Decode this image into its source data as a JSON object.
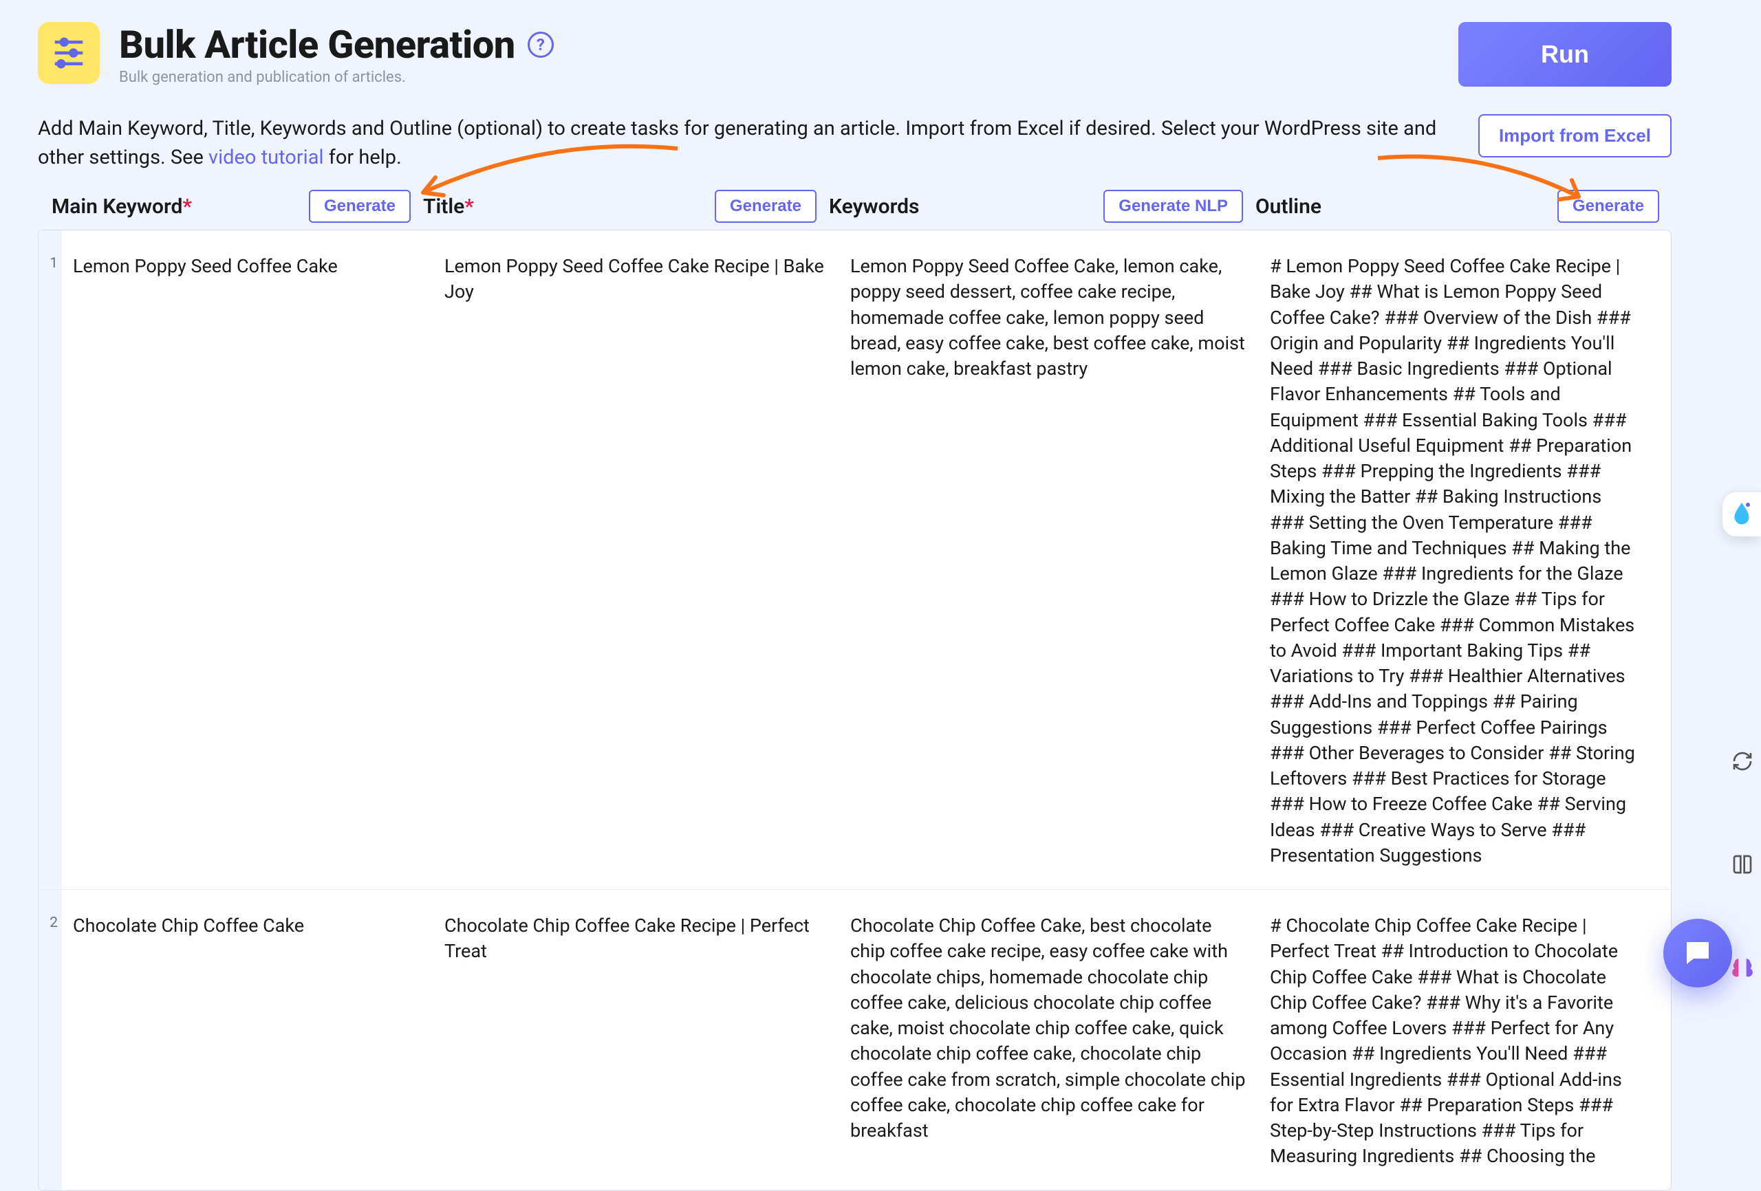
{
  "header": {
    "title": "Bulk Article Generation",
    "subtitle": "Bulk generation and publication of articles.",
    "run_label": "Run",
    "help_glyph": "?"
  },
  "intro": {
    "text_before_link": "Add Main Keyword, Title, Keywords and Outline (optional) to create tasks for generating an article. Import from Excel if desired. Select your WordPress site and other settings. See ",
    "link_text": "video tutorial",
    "text_after_link": " for help.",
    "import_label": "Import from Excel"
  },
  "columns": {
    "main_keyword": {
      "label": "Main Keyword",
      "required": true,
      "button": "Generate"
    },
    "title": {
      "label": "Title",
      "required": true,
      "button": "Generate"
    },
    "keywords": {
      "label": "Keywords",
      "required": false,
      "button": "Generate NLP"
    },
    "outline": {
      "label": "Outline",
      "required": false,
      "button": "Generate"
    }
  },
  "rows": [
    {
      "n": "1",
      "main_keyword": "Lemon Poppy Seed Coffee Cake",
      "title": "Lemon Poppy Seed Coffee Cake Recipe | Bake Joy",
      "keywords": "Lemon Poppy Seed Coffee Cake, lemon cake, poppy seed dessert, coffee cake recipe, homemade coffee cake, lemon poppy seed bread, easy coffee cake, best coffee cake, moist lemon cake, breakfast pastry",
      "outline": "# Lemon Poppy Seed Coffee Cake Recipe | Bake Joy ## What is Lemon Poppy Seed Coffee Cake? ### Overview of the Dish ### Origin and Popularity ## Ingredients You'll Need ### Basic Ingredients ### Optional Flavor Enhancements ## Tools and Equipment ### Essential Baking Tools ### Additional Useful Equipment ## Preparation Steps ### Prepping the Ingredients ### Mixing the Batter ## Baking Instructions ### Setting the Oven Temperature ### Baking Time and Techniques ## Making the Lemon Glaze ### Ingredients for the Glaze ### How to Drizzle the Glaze ## Tips for Perfect Coffee Cake ### Common Mistakes to Avoid ### Important Baking Tips ## Variations to Try ### Healthier Alternatives ### Add-Ins and Toppings ## Pairing Suggestions ### Perfect Coffee Pairings ### Other Beverages to Consider ## Storing Leftovers ### Best Practices for Storage ### How to Freeze Coffee Cake ## Serving Ideas ### Creative Ways to Serve ### Presentation Suggestions"
    },
    {
      "n": "2",
      "main_keyword": "Chocolate Chip Coffee Cake",
      "title": "Chocolate Chip Coffee Cake Recipe | Perfect Treat",
      "keywords": "Chocolate Chip Coffee Cake, best chocolate chip coffee cake recipe, easy coffee cake with chocolate chips, homemade chocolate chip coffee cake, delicious chocolate chip coffee cake, moist chocolate chip coffee cake, quick chocolate chip coffee cake, chocolate chip coffee cake from scratch, simple chocolate chip coffee cake, chocolate chip coffee cake for breakfast",
      "outline": "# Chocolate Chip Coffee Cake Recipe | Perfect Treat ## Introduction to Chocolate Chip Coffee Cake ### What is Chocolate Chip Coffee Cake? ### Why it's a Favorite among Coffee Lovers ### Perfect for Any Occasion ## Ingredients You'll Need ### Essential Ingredients ### Optional Add-ins for Extra Flavor ## Preparation Steps ### Step-by-Step Instructions ### Tips for Measuring Ingredients ## Choosing the"
    }
  ],
  "side_icons": [
    "water-drop-icon",
    "refresh-icon",
    "book-icon",
    "brain-icon"
  ],
  "fab": {
    "name": "chat-icon"
  }
}
